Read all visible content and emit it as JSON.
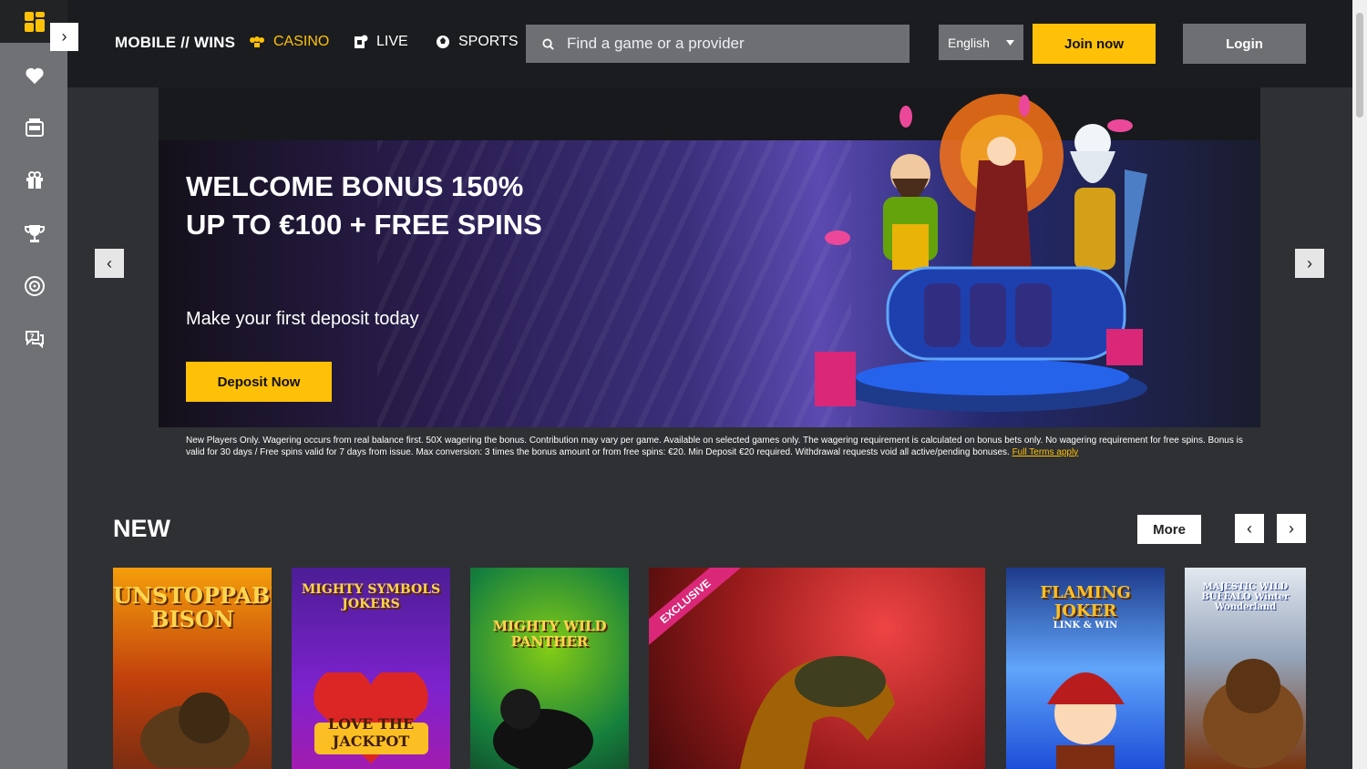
{
  "header": {
    "brand": "MOBILE // WINS",
    "nav": [
      {
        "label": "CASINO",
        "active": true
      },
      {
        "label": "LIVE",
        "active": false
      },
      {
        "label": "SPORTS",
        "active": false
      }
    ],
    "search_placeholder": "Find a game or a provider",
    "language": "English",
    "join_label": "Join now",
    "login_label": "Login"
  },
  "sidebar": {
    "items": [
      "favorites",
      "casino-machine",
      "promotions",
      "tournaments",
      "live-support",
      "help"
    ]
  },
  "hero": {
    "title": "WELCOME BONUS 150% UP TO €100 + FREE SPINS",
    "subtitle": "Make your first deposit today",
    "cta": "Deposit Now",
    "terms": "New Players Only. Wagering occurs from real balance first. 50X wagering the bonus. Contribution may vary per game. Available on selected games only. The wagering requirement is calculated on bonus bets only. No wagering requirement for free spins. Bonus is valid for 30 days / Free spins valid for 7 days from issue. Max conversion: 3 times the bonus amount or from free spins: €20. Min Deposit €20 required. Withdrawal requests void all active/pending bonuses.",
    "terms_link": "Full Terms apply"
  },
  "new_section": {
    "title": "NEW",
    "more_label": "More",
    "games": [
      {
        "title": "UNSTOPPABLE BISON",
        "colors": [
          "#c2410c",
          "#f59e0b"
        ]
      },
      {
        "title": "MIGHTY SYMBOLS JOKERS",
        "subtitle": "LOVE THE JACKPOT",
        "colors": [
          "#5b21b6",
          "#a21caf"
        ]
      },
      {
        "title": "MIGHTY WILD PANTHER",
        "colors": [
          "#15803d",
          "#65a30d"
        ]
      },
      {
        "title": "EXCLUSIVE",
        "colors": [
          "#7f1d1d",
          "#dc2626"
        ]
      },
      {
        "title": "FLAMING JOKER",
        "subtitle": "LINK & WIN",
        "colors": [
          "#1e3a8a",
          "#60a5fa"
        ]
      },
      {
        "title": "MAJESTIC WILD BUFFALO Winter Wonderland",
        "colors": [
          "#cbd5e1",
          "#78350f"
        ]
      }
    ]
  },
  "colors": {
    "accent": "#ffc107",
    "header_bg": "#1a1c1f",
    "page_bg": "#2e3033",
    "sidebar_bg": "#6f7175"
  }
}
